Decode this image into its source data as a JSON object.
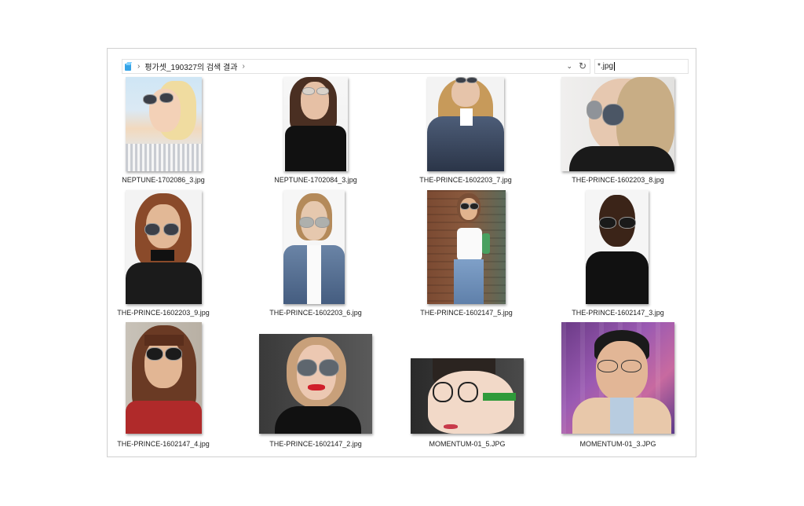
{
  "address_bar": {
    "breadcrumb": "평가셋_190327의 검색 결과",
    "search_query": "*.jpg"
  },
  "files": [
    {
      "name": "NEPTUNE-1702086_3.jpg"
    },
    {
      "name": "NEPTUNE-1702084_3.jpg"
    },
    {
      "name": "THE-PRINCE-1602203_7.jpg"
    },
    {
      "name": "THE-PRINCE-1602203_8.jpg"
    },
    {
      "name": "THE-PRINCE-1602203_9.jpg"
    },
    {
      "name": "THE-PRINCE-1602203_6.jpg"
    },
    {
      "name": "THE-PRINCE-1602147_5.jpg"
    },
    {
      "name": "THE-PRINCE-1602147_3.jpg"
    },
    {
      "name": "THE-PRINCE-1602147_4.jpg"
    },
    {
      "name": "THE-PRINCE-1602147_2.jpg"
    },
    {
      "name": "MOMENTUM-01_5.JPG"
    },
    {
      "name": "MOMENTUM-01_3.JPG"
    }
  ],
  "colors": {
    "location_icon": "#35a3e6",
    "border": "#d0d0d0"
  }
}
